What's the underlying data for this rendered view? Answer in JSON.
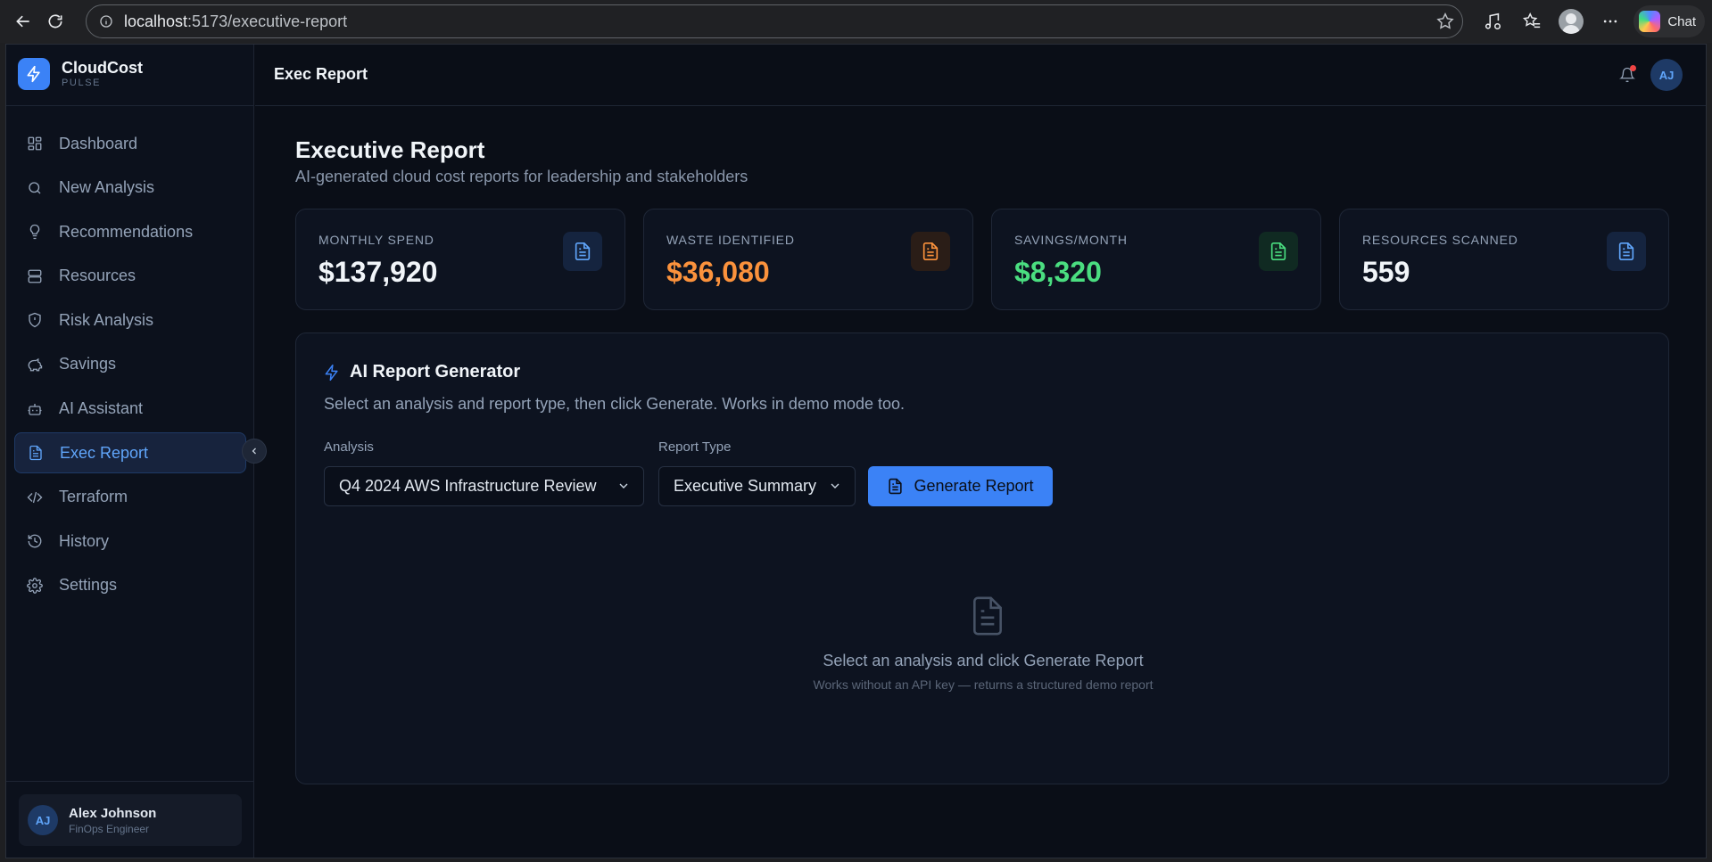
{
  "browser": {
    "url_host": "localhost",
    "url_path": ":5173/executive-report",
    "chat_label": "Chat"
  },
  "brand": {
    "name": "CloudCost",
    "sub": "PULSE"
  },
  "sidebar": {
    "items": [
      {
        "label": "Dashboard",
        "icon": "grid-icon"
      },
      {
        "label": "New Analysis",
        "icon": "search-icon"
      },
      {
        "label": "Recommendations",
        "icon": "lightbulb-icon"
      },
      {
        "label": "Resources",
        "icon": "server-icon"
      },
      {
        "label": "Risk Analysis",
        "icon": "shield-icon"
      },
      {
        "label": "Savings",
        "icon": "piggy-bank-icon"
      },
      {
        "label": "AI Assistant",
        "icon": "bot-icon"
      },
      {
        "label": "Exec Report",
        "icon": "file-text-icon",
        "active": true
      },
      {
        "label": "Terraform",
        "icon": "code-icon"
      },
      {
        "label": "History",
        "icon": "history-icon"
      },
      {
        "label": "Settings",
        "icon": "gear-icon"
      }
    ],
    "user": {
      "initials": "AJ",
      "name": "Alex Johnson",
      "role": "FinOps Engineer"
    }
  },
  "header": {
    "title": "Exec Report",
    "avatar_initials": "AJ"
  },
  "page": {
    "title": "Executive Report",
    "subtitle": "AI-generated cloud cost reports for leadership and stakeholders"
  },
  "stats": [
    {
      "label": "MONTHLY SPEND",
      "value": "$137,920",
      "color": "#f1f5f9",
      "icon_color": "#60a5fa",
      "icon_bg": "#15243f"
    },
    {
      "label": "WASTE IDENTIFIED",
      "value": "$36,080",
      "color": "#fb923c",
      "icon_color": "#fb923c",
      "icon_bg": "#2a1d17"
    },
    {
      "label": "SAVINGS/MONTH",
      "value": "$8,320",
      "color": "#4ade80",
      "icon_color": "#4ade80",
      "icon_bg": "#102a22"
    },
    {
      "label": "RESOURCES SCANNED",
      "value": "559",
      "color": "#f1f5f9",
      "icon_color": "#60a5fa",
      "icon_bg": "#15243f"
    }
  ],
  "generator": {
    "title": "AI Report Generator",
    "description": "Select an analysis and report type, then click Generate. Works in demo mode too.",
    "analysis_label": "Analysis",
    "analysis_value": "Q4 2024 AWS Infrastructure Review",
    "report_type_label": "Report Type",
    "report_type_value": "Executive Summary",
    "generate_label": "Generate Report",
    "empty_title": "Select an analysis and click Generate Report",
    "empty_sub": "Works without an API key — returns a structured demo report"
  },
  "colors": {
    "accent": "#3b82f6",
    "background": "#0a0e17"
  }
}
